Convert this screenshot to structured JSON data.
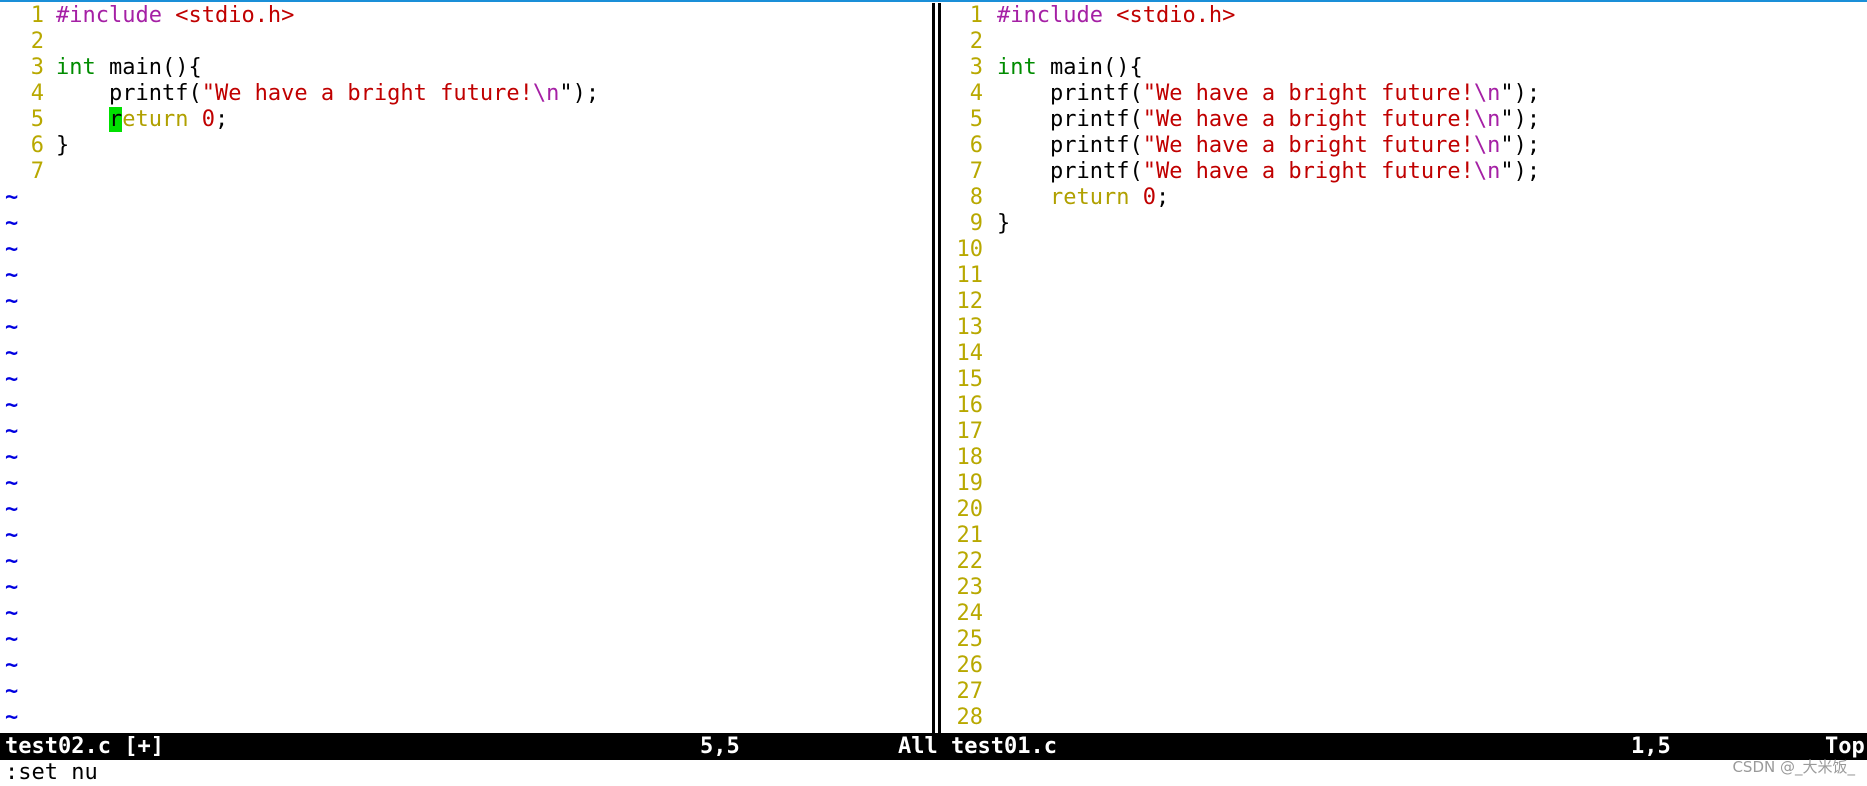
{
  "left_pane": {
    "code": {
      "include_directive": "#include",
      "include_header": "<stdio.h>",
      "type_int": "int",
      "main_sig": " main(){",
      "printf_name": "printf(",
      "printf_str": "\"We have a bright future!",
      "printf_esc": "\\n",
      "printf_tail": "\");",
      "return_cursor_char": "r",
      "return_rest": "eturn",
      "return_value": "0",
      "semicolon": ";",
      "close_brace": "}"
    },
    "line_numbers": [
      "1",
      "2",
      "3",
      "4",
      "5",
      "6",
      "7"
    ],
    "tilde": "~"
  },
  "right_pane": {
    "code": {
      "include_directive": "#include",
      "include_header": "<stdio.h>",
      "type_int": "int",
      "main_sig": " main(){",
      "printf_name": "printf(",
      "printf_str": "\"We have a bright future!",
      "printf_esc": "\\n",
      "printf_tail": "\");",
      "return_kw": "return",
      "return_value": "0",
      "semicolon": ";",
      "close_brace": "}"
    },
    "line_numbers": [
      "1",
      "2",
      "3",
      "4",
      "5",
      "6",
      "7",
      "8",
      "9",
      "10",
      "11",
      "12",
      "13",
      "14",
      "15",
      "16",
      "17",
      "18",
      "19",
      "20",
      "21",
      "22",
      "23",
      "24",
      "25",
      "26",
      "27",
      "28"
    ]
  },
  "status_left": {
    "filename": "test02.c [+]",
    "position": "5,5",
    "scroll": "All"
  },
  "status_right": {
    "filename": "test01.c",
    "position": "1,5",
    "scroll": "Top"
  },
  "command_line": ":set nu",
  "watermark": "CSDN @_大米饭_",
  "colors": {
    "line_number": "#b8a800",
    "preprocessor": "#a520a5",
    "string": "#c00000",
    "type": "#008c00",
    "keyword": "#b0a000",
    "tilde": "#0000e0",
    "cursor": "#00e000"
  }
}
